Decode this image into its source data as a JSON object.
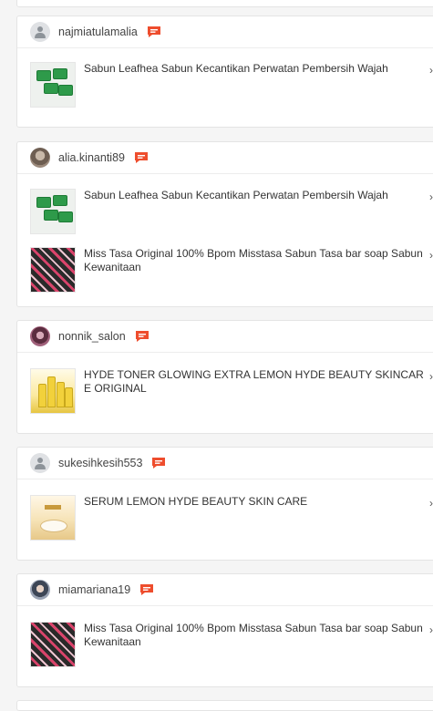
{
  "colors": {
    "accent": "#ee4d2d",
    "card_bg": "#ffffff",
    "page_bg": "#f5f5f5"
  },
  "cards": [
    {
      "username": "najmiatulamalia",
      "avatar": "default-avatar",
      "products": [
        {
          "name": "Sabun Leafhea Sabun Kecantikan Perwatan Pembersih Wajah",
          "thumb": "leafhea"
        }
      ]
    },
    {
      "username": "alia.kinanti89",
      "avatar": "photo",
      "products": [
        {
          "name": "Sabun Leafhea Sabun Kecantikan Perwatan Pembersih Wajah",
          "thumb": "leafhea"
        },
        {
          "name": "Miss Tasa Original 100% Bpom Misstasa Sabun Tasa bar soap Sabun Kewanitaan",
          "thumb": "misstasa"
        }
      ]
    },
    {
      "username": "nonnik_salon",
      "avatar": "photo",
      "products": [
        {
          "name": "HYDE TONER GLOWING EXTRA LEMON HYDE BEAUTY SKINCARE ORIGINAL",
          "thumb": "hyde"
        }
      ]
    },
    {
      "username": "sukesihkesih553",
      "avatar": "default-avatar",
      "products": [
        {
          "name": "SERUM LEMON HYDE BEAUTY SKIN CARE",
          "thumb": "serum"
        }
      ]
    },
    {
      "username": "miamariana19",
      "avatar": "photo",
      "products": [
        {
          "name": "Miss Tasa Original 100% Bpom Misstasa Sabun Tasa bar soap Sabun Kewanitaan",
          "thumb": "misstasa"
        }
      ]
    }
  ],
  "icons": {
    "chat": "chat-bubble-icon",
    "chevron": "chevron-right-icon"
  }
}
